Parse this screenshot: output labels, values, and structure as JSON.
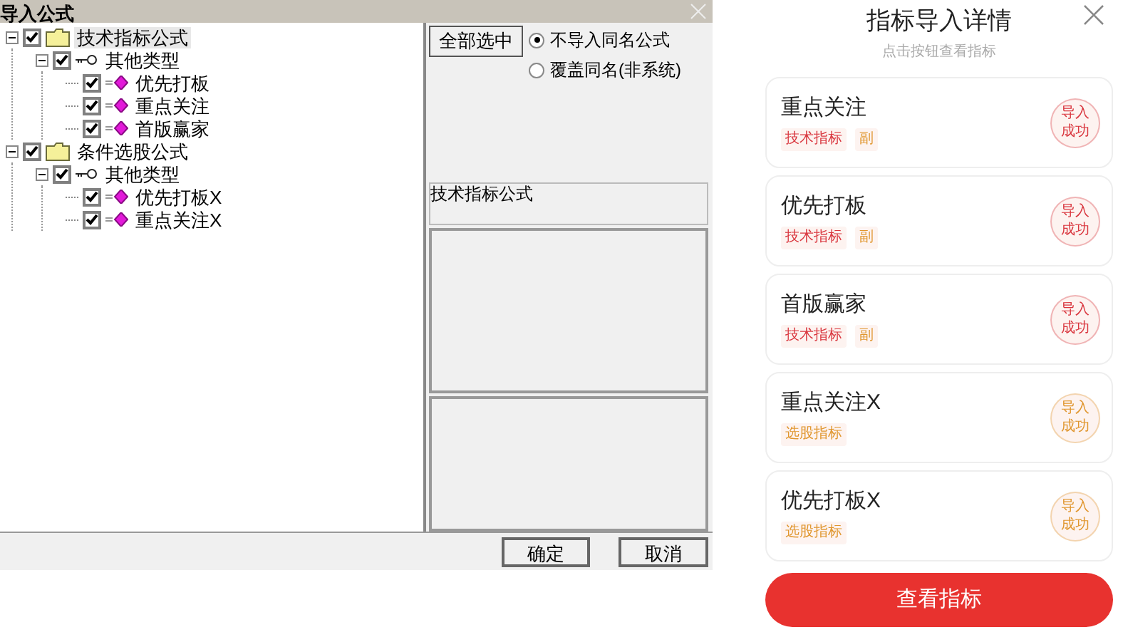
{
  "dialog": {
    "title": "导入公式",
    "tree": [
      {
        "label": "技术指标公式",
        "kind": "folder",
        "checked": true,
        "expanded": true,
        "selected": true,
        "children": [
          {
            "label": "其他类型",
            "kind": "key",
            "checked": true,
            "expanded": true,
            "selected": false,
            "children": [
              {
                "label": "优先打板",
                "kind": "gem",
                "checked": true,
                "selected": false
              },
              {
                "label": "重点关注",
                "kind": "gem",
                "checked": true,
                "selected": false
              },
              {
                "label": "首版赢家",
                "kind": "gem",
                "checked": true,
                "selected": false
              }
            ]
          }
        ]
      },
      {
        "label": "条件选股公式",
        "kind": "folder",
        "checked": true,
        "expanded": true,
        "selected": false,
        "children": [
          {
            "label": "其他类型",
            "kind": "key",
            "checked": true,
            "expanded": true,
            "selected": false,
            "children": [
              {
                "label": "优先打板X",
                "kind": "gem",
                "checked": true,
                "selected": false
              },
              {
                "label": "重点关注X",
                "kind": "gem",
                "checked": true,
                "selected": false
              }
            ]
          }
        ]
      }
    ],
    "select_all_button": "全部选中",
    "options": [
      {
        "label": "不导入同名公式",
        "selected": true
      },
      {
        "label": "覆盖同名(非系统)",
        "selected": false
      }
    ],
    "category_field": "技术指标公式",
    "ok_button": "确定",
    "cancel_button": "取消"
  },
  "panel": {
    "title": "指标导入详情",
    "subtitle": "点击按钮查看指标",
    "cards": [
      {
        "name": "重点关注",
        "tags": [
          {
            "label": "技术指标",
            "color": "#d9363e"
          },
          {
            "label": "副",
            "color": "#e0962e"
          }
        ],
        "status": "导入成功",
        "color": "#d9363e"
      },
      {
        "name": "优先打板",
        "tags": [
          {
            "label": "技术指标",
            "color": "#d9363e"
          },
          {
            "label": "副",
            "color": "#e0962e"
          }
        ],
        "status": "导入成功",
        "color": "#d9363e"
      },
      {
        "name": "首版赢家",
        "tags": [
          {
            "label": "技术指标",
            "color": "#d9363e"
          },
          {
            "label": "副",
            "color": "#e0962e"
          }
        ],
        "status": "导入成功",
        "color": "#d9363e"
      },
      {
        "name": "重点关注X",
        "tags": [
          {
            "label": "选股指标",
            "color": "#e0962e"
          }
        ],
        "status": "导入成功",
        "color": "#e0962e"
      },
      {
        "name": "优先打板X",
        "tags": [
          {
            "label": "选股指标",
            "color": "#e0962e"
          }
        ],
        "status": "导入成功",
        "color": "#e0962e"
      }
    ],
    "view_button": "查看指标"
  }
}
